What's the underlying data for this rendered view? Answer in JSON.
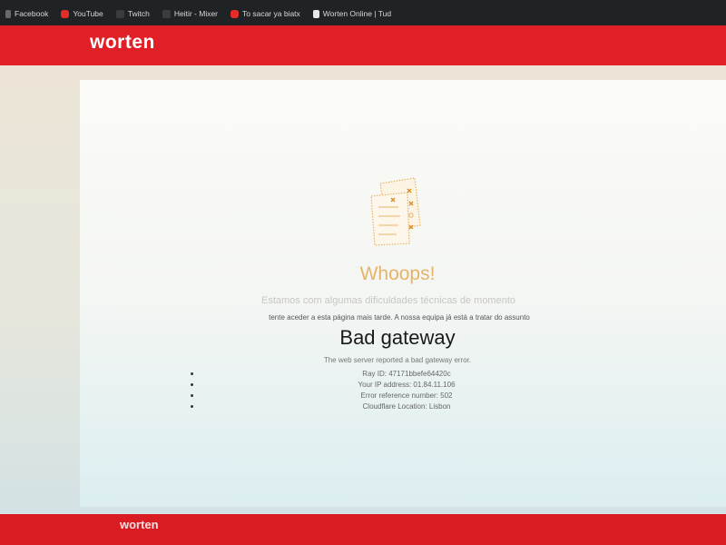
{
  "bookmarks": [
    {
      "label": "Facebook",
      "icon": "facebook-icon"
    },
    {
      "label": "YouTube",
      "icon": "youtube-icon"
    },
    {
      "label": "Twitch",
      "icon": "twitch-icon"
    },
    {
      "label": "Heitir - Mixer",
      "icon": "mixer-icon"
    },
    {
      "label": "To sacar ya biatx",
      "icon": "youtube-icon"
    },
    {
      "label": "Worten Online | Tud",
      "icon": "document-icon"
    }
  ],
  "header": {
    "logo": "worten"
  },
  "error": {
    "title": "Whoops!",
    "subtitle": "Estamos com algumas dificuldades técnicas de momento",
    "subtitle2": "tente aceder a esta página mais tarde. A nossa equipa já está a tratar do assunto",
    "heading": "Bad gateway",
    "description": "The web server reported a bad gateway error.",
    "details": [
      "Ray ID: 47171bbefe64420c",
      "Your IP address: 01.84.11.106",
      "Error reference number: 502",
      "Cloudflare Location: Lisbon"
    ]
  },
  "footer": {
    "logo": "worten"
  },
  "colors": {
    "brand_red": "#e01f26",
    "whoops_orange": "#e6b466",
    "page_background": "#ece5d7"
  }
}
